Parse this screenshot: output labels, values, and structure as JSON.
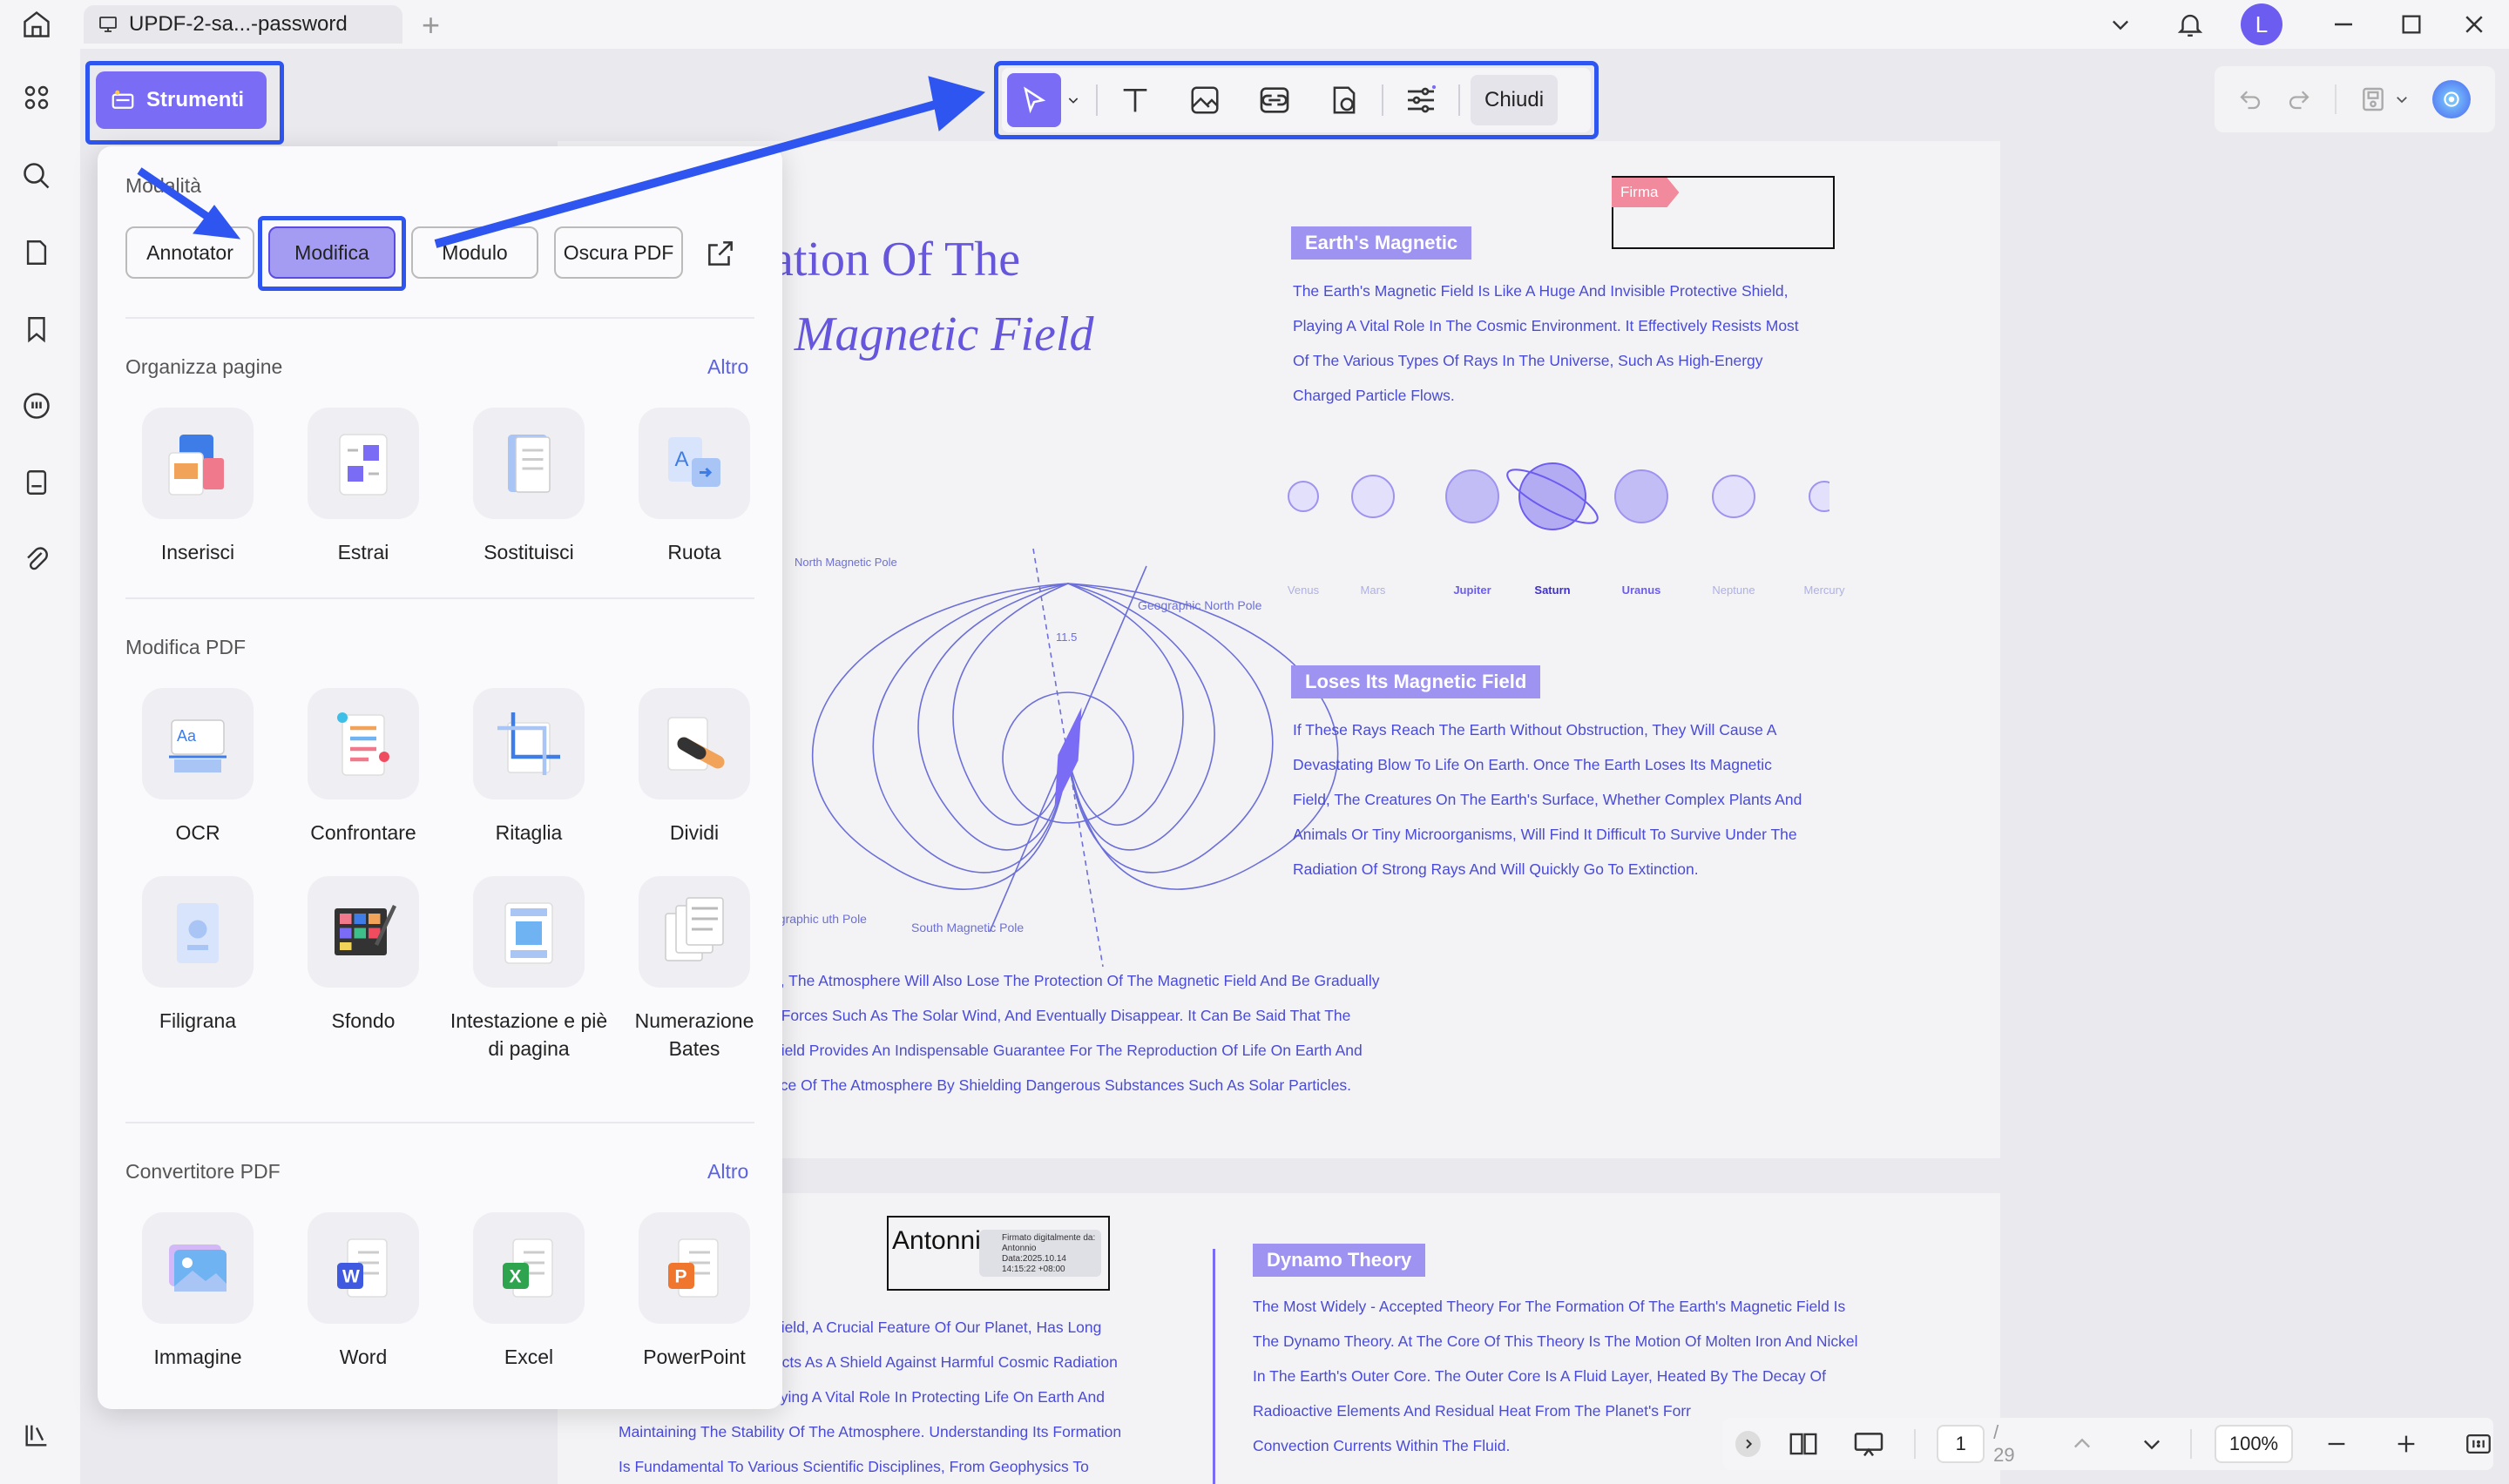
{
  "tab": {
    "title": "UPDF-2-sa...-password",
    "new_tab": "+"
  },
  "user": {
    "avatar_letter": "L"
  },
  "strumenti": {
    "label": "Strumenti"
  },
  "toolbar": {
    "close_label": "Chiudi"
  },
  "panel": {
    "mode_title": "Modalità",
    "modes": [
      "Annotator",
      "Modifica",
      "Modulo",
      "Oscura PDF"
    ],
    "selected_mode": "Modifica",
    "organize": {
      "title": "Organizza pagine",
      "more": "Altro",
      "items": [
        "Inserisci",
        "Estrai",
        "Sostituisci",
        "Ruota"
      ]
    },
    "edit": {
      "title": "Modifica PDF",
      "items": [
        "OCR",
        "Confrontare",
        "Ritaglia",
        "Dividi",
        "Filigrana",
        "Sfondo",
        "Intestazione e piè di pagina",
        "Numerazione Bates"
      ]
    },
    "convert": {
      "title": "Convertitore PDF",
      "more": "Altro",
      "items": [
        "Immagine",
        "Word",
        "Excel",
        "PowerPoint"
      ]
    }
  },
  "doc": {
    "title_line1": "ation Of The",
    "title_line2": "s Magnetic Field",
    "firma": "Firma",
    "earth_magnetic": {
      "title": "Earth's Magnetic",
      "lines": [
        "The Earth's Magnetic Field Is Like A Huge And Invisible Protective Shield,",
        "Playing A Vital Role In The Cosmic Environment. It Effectively Resists Most",
        "Of The Various Types Of Rays In The Universe, Such As High-Energy",
        "Charged Particle Flows."
      ]
    },
    "planets": [
      "Venus",
      "Mars",
      "Jupiter",
      "Saturn",
      "Uranus",
      "Neptune",
      "Mercury"
    ],
    "diagram_labels": {
      "north_mag": "North Magnetic Pole",
      "geo_north": "Geographic North Pole",
      "angle": "11.5",
      "geo_south": "ographic uth Pole",
      "south_mag": "South Magnetic Pole"
    },
    "loses": {
      "title": "Loses Its Magnetic Field",
      "lines": [
        "If These Rays Reach The Earth Without Obstruction, They Will Cause A",
        "Devastating Blow To Life On Earth. Once The Earth Loses Its Magnetic",
        "Field, The Creatures On The Earth's Surface, Whether Complex Plants And",
        "Animals Or Tiny Microorganisms, Will Find It Difficult To Survive Under The",
        "Radiation Of Strong Rays And Will Quickly Go To Extinction."
      ]
    },
    "bottom_lines": [
      "e, The Atmosphere Will Also Lose The Protection Of The Magnetic Field And Be Gradually",
      "r Forces Such As The Solar Wind, And Eventually Disappear. It Can Be Said That The",
      "Field Provides An Indispensable Guarantee For The Reproduction Of Life On Earth And",
      "nce Of The Atmosphere By Shielding Dangerous Substances Such As Solar Particles."
    ],
    "page2": {
      "signature_name": "Antonnio",
      "signature_detail": "Firmato digitalmente da: Antonnio Data:2025.10.14 14:15:22 +08:00",
      "left_lines": [
        "Field, A Crucial Feature Of Our Planet, Has Long",
        "Acts As A Shield Against Harmful Cosmic Radiation",
        "aying A Vital Role In Protecting Life On Earth And",
        "Maintaining The Stability Of The Atmosphere. Understanding Its Formation",
        "Is Fundamental To Various Scientific Disciplines, From Geophysics To"
      ],
      "dynamo_title": "Dynamo Theory",
      "dynamo_lines": [
        "The Most Widely - Accepted Theory For The Formation Of The Earth's Magnetic Field Is",
        "The Dynamo Theory. At The Core Of This Theory Is The Motion Of Molten Iron And Nickel",
        "In The Earth's Outer Core. The Outer Core Is A Fluid Layer, Heated By The Decay Of",
        "Radioactive Elements And Residual Heat From The Planet's Forr",
        "Convection Currents Within The Fluid."
      ]
    }
  },
  "nav": {
    "page": "1",
    "total": "/ 29",
    "zoom": "100%"
  },
  "colors": {
    "accent": "#7a6cf5",
    "highlight": "#2f55f1",
    "doc_text": "#4a4bd6"
  }
}
